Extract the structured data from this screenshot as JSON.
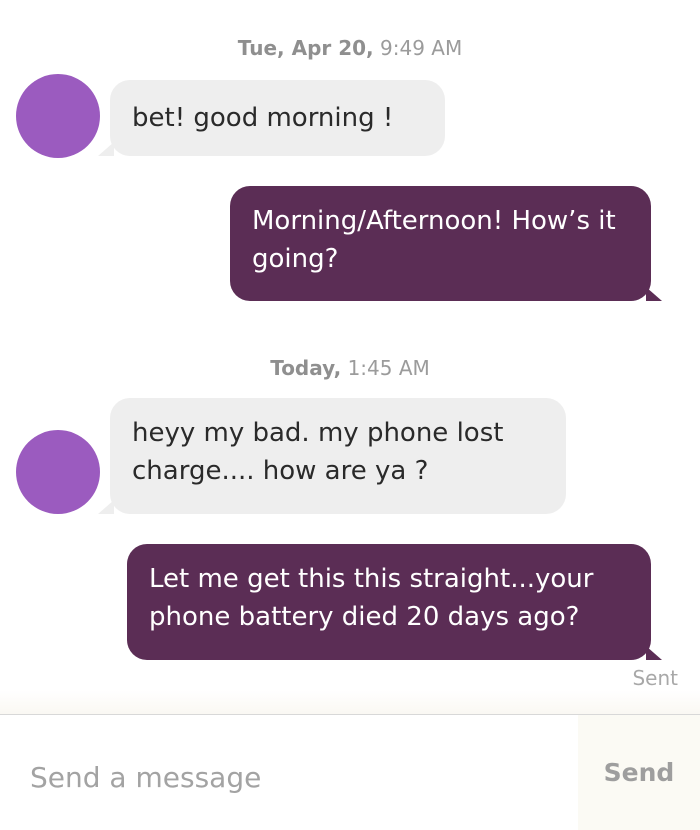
{
  "thread": {
    "sections": [
      {
        "day": "Tue, Apr 20,",
        "time": "9:49 AM"
      },
      {
        "day": "Today,",
        "time": "1:45 AM"
      }
    ],
    "messages": [
      {
        "direction": "in",
        "text": "bet! good morning !"
      },
      {
        "direction": "out",
        "text": "Morning/Afternoon! How’s it going?"
      },
      {
        "direction": "in",
        "text": "heyy my bad. my phone lost charge.... how are ya ?"
      },
      {
        "direction": "out",
        "text": "Let me get this this straight...your phone battery died 20 days ago?"
      }
    ],
    "status": "Sent"
  },
  "composer": {
    "placeholder": "Send a message",
    "send_label": "Send"
  },
  "colors": {
    "outgoing_bubble": "#5b2d55",
    "incoming_bubble": "#eeeeee",
    "avatar": "#9b5bbf"
  }
}
